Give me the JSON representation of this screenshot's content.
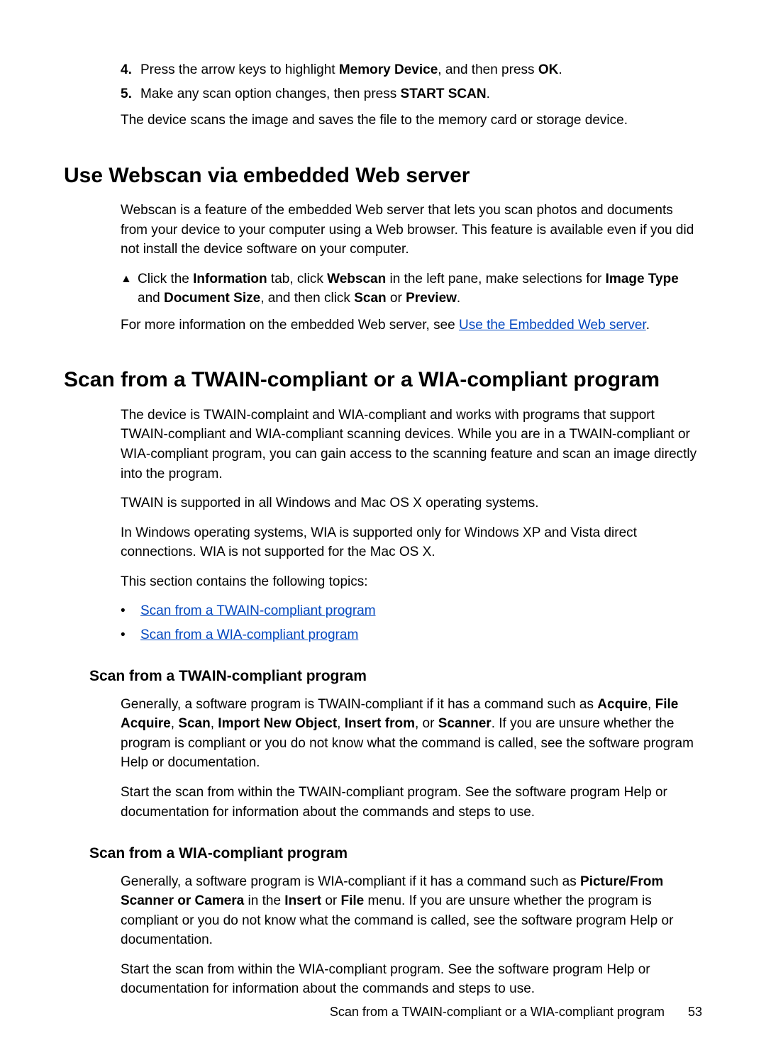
{
  "top_steps": {
    "step4_num": "4.",
    "step4_pre": "Press the arrow keys to highlight ",
    "step4_b1": "Memory Device",
    "step4_mid": ", and then press ",
    "step4_b2": "OK",
    "step4_end": ".",
    "step5_num": "5.",
    "step5_pre": "Make any scan option changes, then press ",
    "step5_b1": "START SCAN",
    "step5_end": ".",
    "result": "The device scans the image and saves the file to the memory card or storage device."
  },
  "webscan": {
    "heading": "Use Webscan via embedded Web server",
    "intro": "Webscan is a feature of the embedded Web server that lets you scan photos and documents from your device to your computer using a Web browser. This feature is available even if you did not install the device software on your computer.",
    "step_pre": "Click the ",
    "step_b1": "Information",
    "step_mid1": " tab, click ",
    "step_b2": "Webscan",
    "step_mid2": " in the left pane, make selections for ",
    "step_b3": "Image Type",
    "step_mid3": " and ",
    "step_b4": "Document Size",
    "step_mid4": ", and then click ",
    "step_b5": "Scan",
    "step_mid5": " or ",
    "step_b6": "Preview",
    "step_end": ".",
    "more_pre": "For more information on the embedded Web server, see ",
    "more_link": "Use the Embedded Web server",
    "more_end": "."
  },
  "twain_wia": {
    "heading": "Scan from a TWAIN-compliant or a WIA-compliant program",
    "p1": "The device is TWAIN-complaint and WIA-compliant and works with programs that support TWAIN-compliant and WIA-compliant scanning devices. While you are in a TWAIN-compliant or WIA-compliant program, you can gain access to the scanning feature and scan an image directly into the program.",
    "p2": "TWAIN is supported in all Windows and Mac OS X operating systems.",
    "p3": "In Windows operating systems, WIA is supported only for Windows XP and Vista direct connections. WIA is not supported for the Mac OS X.",
    "p4": "This section contains the following topics:",
    "link1": "Scan from a TWAIN-compliant program",
    "link2": "Scan from a WIA-compliant program"
  },
  "twain": {
    "heading": "Scan from a TWAIN-compliant program",
    "p1_pre": "Generally, a software program is TWAIN-compliant if it has a command such as ",
    "b1": "Acquire",
    "sep": ", ",
    "b2": "File Acquire",
    "b3": "Scan",
    "b4": "Import New Object",
    "b5": "Insert from",
    "or": ", or ",
    "b6": "Scanner",
    "p1_end": ". If you are unsure whether the program is compliant or you do not know what the command is called, see the software program Help or documentation.",
    "p2": "Start the scan from within the TWAIN-compliant program. See the software program Help or documentation for information about the commands and steps to use."
  },
  "wia": {
    "heading": "Scan from a WIA-compliant program",
    "p1_pre": "Generally, a software program is WIA-compliant if it has a command such as ",
    "b1": "Picture/From Scanner or Camera",
    "mid1": " in the ",
    "b2": "Insert",
    "mid2": " or ",
    "b3": "File",
    "p1_end": " menu. If you are unsure whether the program is compliant or you do not know what the command is called, see the software program Help or documentation.",
    "p2": "Start the scan from within the WIA-compliant program. See the software program Help or documentation for information about the commands and steps to use."
  },
  "footer": {
    "text": "Scan from a TWAIN-compliant or a WIA-compliant program",
    "page": "53"
  }
}
